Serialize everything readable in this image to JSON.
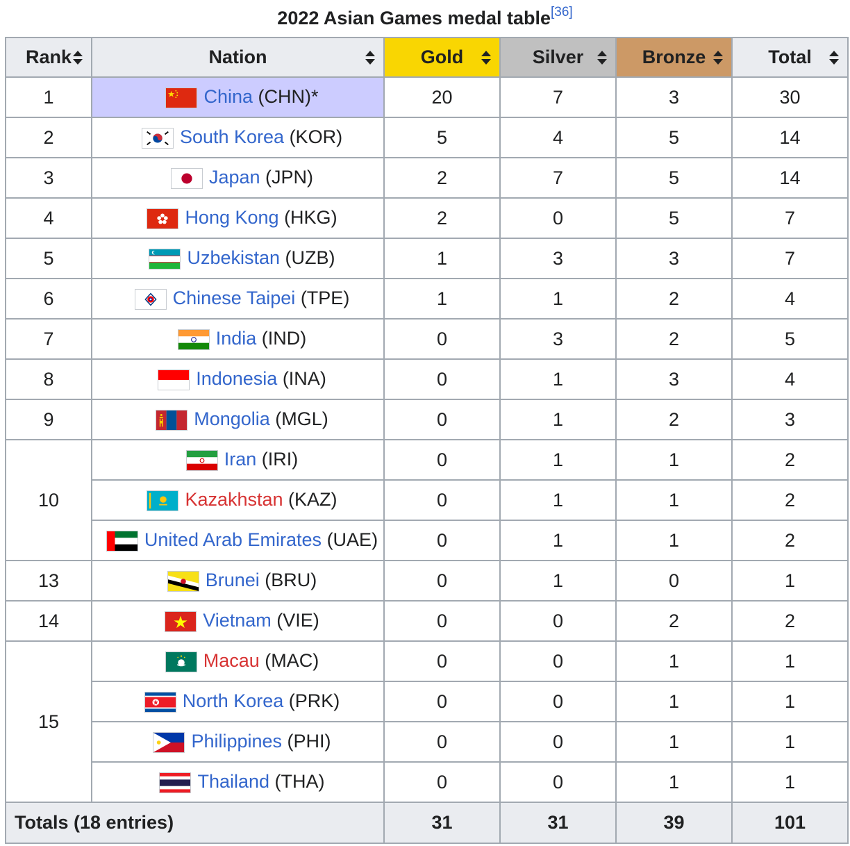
{
  "caption": {
    "title": "2022 Asian Games medal table",
    "ref": "[36]"
  },
  "columns": {
    "rank": "Rank",
    "nation": "Nation",
    "gold": "Gold",
    "silver": "Silver",
    "bronze": "Bronze",
    "total": "Total"
  },
  "colors": {
    "gold": "#f9d602",
    "silver": "#c0c0c0",
    "bronze": "#cc9966",
    "host": "#ccccff",
    "link": "#3366cc",
    "redlink": "#d73333",
    "header": "#eaecf0",
    "border": "#a2a9b1"
  },
  "rows": [
    {
      "rank": "1",
      "rankspan": 1,
      "name": "China",
      "code": "(CHN)*",
      "host": true,
      "red": false,
      "flag": "china-flag-icon",
      "gold": "20",
      "silver": "7",
      "bronze": "3",
      "total": "30"
    },
    {
      "rank": "2",
      "rankspan": 1,
      "name": "South Korea",
      "code": "(KOR)",
      "red": false,
      "flag": "south-korea-flag-icon",
      "gold": "5",
      "silver": "4",
      "bronze": "5",
      "total": "14"
    },
    {
      "rank": "3",
      "rankspan": 1,
      "name": "Japan",
      "code": "(JPN)",
      "red": false,
      "flag": "japan-flag-icon",
      "gold": "2",
      "silver": "7",
      "bronze": "5",
      "total": "14"
    },
    {
      "rank": "4",
      "rankspan": 1,
      "name": "Hong Kong",
      "code": "(HKG)",
      "red": false,
      "flag": "hong-kong-flag-icon",
      "gold": "2",
      "silver": "0",
      "bronze": "5",
      "total": "7"
    },
    {
      "rank": "5",
      "rankspan": 1,
      "name": "Uzbekistan",
      "code": "(UZB)",
      "red": false,
      "flag": "uzbekistan-flag-icon",
      "gold": "1",
      "silver": "3",
      "bronze": "3",
      "total": "7"
    },
    {
      "rank": "6",
      "rankspan": 1,
      "name": "Chinese Taipei",
      "code": "(TPE)",
      "red": false,
      "flag": "chinese-taipei-flag-icon",
      "gold": "1",
      "silver": "1",
      "bronze": "2",
      "total": "4"
    },
    {
      "rank": "7",
      "rankspan": 1,
      "name": "India",
      "code": "(IND)",
      "red": false,
      "flag": "india-flag-icon",
      "gold": "0",
      "silver": "3",
      "bronze": "2",
      "total": "5"
    },
    {
      "rank": "8",
      "rankspan": 1,
      "name": "Indonesia",
      "code": "(INA)",
      "red": false,
      "flag": "indonesia-flag-icon",
      "gold": "0",
      "silver": "1",
      "bronze": "3",
      "total": "4"
    },
    {
      "rank": "9",
      "rankspan": 1,
      "name": "Mongolia",
      "code": "(MGL)",
      "red": false,
      "flag": "mongolia-flag-icon",
      "gold": "0",
      "silver": "1",
      "bronze": "2",
      "total": "3"
    },
    {
      "rank": "10",
      "rankspan": 3,
      "name": "Iran",
      "code": "(IRI)",
      "red": false,
      "flag": "iran-flag-icon",
      "gold": "0",
      "silver": "1",
      "bronze": "1",
      "total": "2"
    },
    {
      "rank": "",
      "rankspan": 0,
      "name": "Kazakhstan",
      "code": "(KAZ)",
      "red": true,
      "flag": "kazakhstan-flag-icon",
      "gold": "0",
      "silver": "1",
      "bronze": "1",
      "total": "2"
    },
    {
      "rank": "",
      "rankspan": 0,
      "name": "United Arab Emirates",
      "code": "(UAE)",
      "red": false,
      "flag": "uae-flag-icon",
      "gold": "0",
      "silver": "1",
      "bronze": "1",
      "total": "2"
    },
    {
      "rank": "13",
      "rankspan": 1,
      "name": "Brunei",
      "code": "(BRU)",
      "red": false,
      "flag": "brunei-flag-icon",
      "gold": "0",
      "silver": "1",
      "bronze": "0",
      "total": "1"
    },
    {
      "rank": "14",
      "rankspan": 1,
      "name": "Vietnam",
      "code": "(VIE)",
      "red": false,
      "flag": "vietnam-flag-icon",
      "gold": "0",
      "silver": "0",
      "bronze": "2",
      "total": "2"
    },
    {
      "rank": "15",
      "rankspan": 4,
      "name": "Macau",
      "code": "(MAC)",
      "red": true,
      "flag": "macau-flag-icon",
      "gold": "0",
      "silver": "0",
      "bronze": "1",
      "total": "1"
    },
    {
      "rank": "",
      "rankspan": 0,
      "name": "North Korea",
      "code": "(PRK)",
      "red": false,
      "flag": "north-korea-flag-icon",
      "gold": "0",
      "silver": "0",
      "bronze": "1",
      "total": "1"
    },
    {
      "rank": "",
      "rankspan": 0,
      "name": "Philippines",
      "code": "(PHI)",
      "red": false,
      "flag": "philippines-flag-icon",
      "gold": "0",
      "silver": "0",
      "bronze": "1",
      "total": "1"
    },
    {
      "rank": "",
      "rankspan": 0,
      "name": "Thailand",
      "code": "(THA)",
      "red": false,
      "flag": "thailand-flag-icon",
      "gold": "0",
      "silver": "0",
      "bronze": "1",
      "total": "1"
    }
  ],
  "totals": {
    "label": "Totals (18 entries)",
    "gold": "31",
    "silver": "31",
    "bronze": "39",
    "total": "101"
  }
}
